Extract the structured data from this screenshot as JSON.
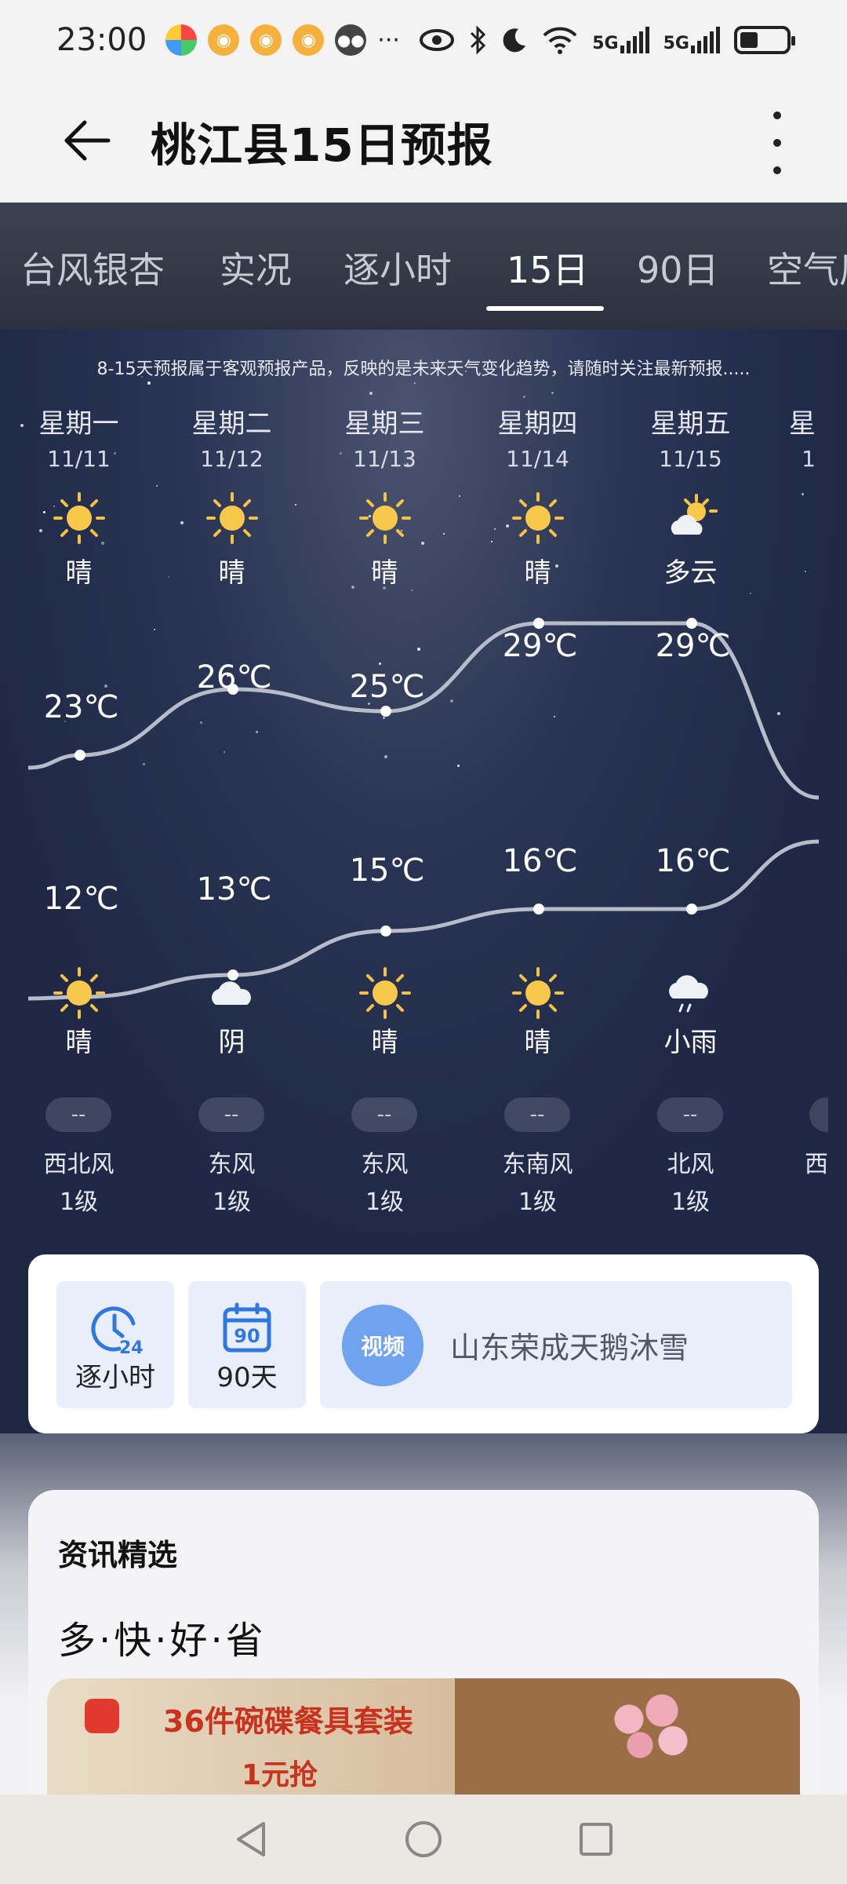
{
  "status_bar": {
    "time": "23:00",
    "network_5g_1": "5G",
    "network_5g_2": "5G"
  },
  "header": {
    "title": "桃江县15日预报"
  },
  "tabs": [
    {
      "label": "台风银杏"
    },
    {
      "label": "实况"
    },
    {
      "label": "逐小时"
    },
    {
      "label": "15日",
      "active": true
    },
    {
      "label": "90日"
    },
    {
      "label": "空气质"
    }
  ],
  "notice": "8-15天预报属于客观预报产品，反映的是未来天气变化趋势，请随时关注最新预报.....",
  "days": [
    {
      "weekday": "星期一",
      "date": "11/11",
      "day_cond": "晴",
      "day_icon": "sun-icon",
      "high": "23℃",
      "low": "12℃",
      "night_cond": "晴",
      "night_icon": "sun-icon",
      "aqi": "--",
      "wind_dir": "西北风",
      "wind_level": "1级"
    },
    {
      "weekday": "星期二",
      "date": "11/12",
      "day_cond": "晴",
      "day_icon": "sun-icon",
      "high": "26℃",
      "low": "13℃",
      "night_cond": "阴",
      "night_icon": "cloud-icon",
      "aqi": "--",
      "wind_dir": "东风",
      "wind_level": "1级"
    },
    {
      "weekday": "星期三",
      "date": "11/13",
      "day_cond": "晴",
      "day_icon": "sun-icon",
      "high": "25℃",
      "low": "15℃",
      "night_cond": "晴",
      "night_icon": "sun-icon",
      "aqi": "--",
      "wind_dir": "东风",
      "wind_level": "1级"
    },
    {
      "weekday": "星期四",
      "date": "11/14",
      "day_cond": "晴",
      "day_icon": "sun-icon",
      "high": "29℃",
      "low": "16℃",
      "night_cond": "晴",
      "night_icon": "sun-icon",
      "aqi": "--",
      "wind_dir": "东南风",
      "wind_level": "1级"
    },
    {
      "weekday": "星期五",
      "date": "11/15",
      "day_cond": "多云",
      "day_icon": "partly-cloudy-icon",
      "high": "29℃",
      "low": "16℃",
      "night_cond": "小雨",
      "night_icon": "light-rain-icon",
      "aqi": "--",
      "wind_dir": "北风",
      "wind_level": "1级"
    },
    {
      "weekday": "星",
      "date": "1",
      "aqi": "",
      "wind_dir": "西"
    }
  ],
  "chart_data": {
    "type": "line",
    "categories": [
      "11/11",
      "11/12",
      "11/13",
      "11/14",
      "11/15"
    ],
    "series": [
      {
        "values": [
          23,
          26,
          25,
          29,
          29
        ]
      },
      {
        "values": [
          12,
          13,
          15,
          16,
          16
        ]
      }
    ]
  },
  "quick": {
    "hourly_label": "逐小时",
    "hourly_icon_text": "24",
    "day90_label": "90天",
    "day90_icon_text": "90",
    "video_badge": "视频",
    "video_text": "山东荣成天鹅沐雪"
  },
  "news": {
    "title": "资讯精选",
    "subtitle": "多·快·好·省",
    "ad_line1": "36件碗碟餐具套装",
    "ad_line2": "1元抢"
  }
}
